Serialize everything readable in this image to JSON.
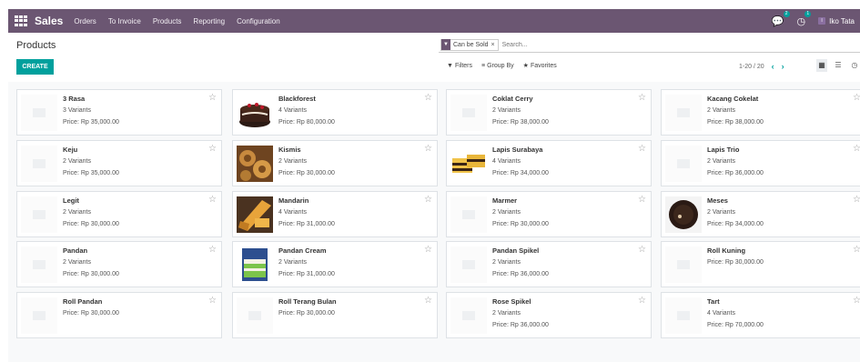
{
  "navbar": {
    "app_name": "Sales",
    "menu": [
      "Orders",
      "To Invoice",
      "Products",
      "Reporting",
      "Configuration"
    ],
    "messages_count": "2",
    "activities_count": "1",
    "user_name": "Iko Tata"
  },
  "control": {
    "title": "Products",
    "create_label": "CREATE",
    "facet_label": "Can be Sold",
    "search_placeholder": "Search...",
    "filters_label": "Filters",
    "groupby_label": "Group By",
    "favorites_label": "Favorites",
    "pager": "1-20 / 20"
  },
  "products": [
    {
      "name": "3 Rasa",
      "variants": "3 Variants",
      "price": "Price: Rp 35,000.00",
      "image": "placeholder"
    },
    {
      "name": "Blackforest",
      "variants": "4 Variants",
      "price": "Price: Rp 80,000.00",
      "image": "cake-photo"
    },
    {
      "name": "Coklat Cerry",
      "variants": "2 Variants",
      "price": "Price: Rp 38,000.00",
      "image": "placeholder"
    },
    {
      "name": "Kacang Cokelat",
      "variants": "2 Variants",
      "price": "Price: Rp 38,000.00",
      "image": "placeholder"
    },
    {
      "name": "Keju",
      "variants": "2 Variants",
      "price": "Price: Rp 35,000.00",
      "image": "placeholder"
    },
    {
      "name": "Kismis",
      "variants": "2 Variants",
      "price": "Price: Rp 30,000.00",
      "image": "roll-photo"
    },
    {
      "name": "Lapis Surabaya",
      "variants": "4 Variants",
      "price": "Price: Rp 34,000.00",
      "image": "layer-photo"
    },
    {
      "name": "Lapis Trio",
      "variants": "2 Variants",
      "price": "Price: Rp 36,000.00",
      "image": "placeholder"
    },
    {
      "name": "Legit",
      "variants": "2 Variants",
      "price": "Price: Rp 30,000.00",
      "image": "placeholder"
    },
    {
      "name": "Mandarin",
      "variants": "4 Variants",
      "price": "Price: Rp 31,000.00",
      "image": "orange-cake-photo"
    },
    {
      "name": "Marmer",
      "variants": "2 Variants",
      "price": "Price: Rp 30,000.00",
      "image": "placeholder"
    },
    {
      "name": "Meses",
      "variants": "2 Variants",
      "price": "Price: Rp 34,000.00",
      "image": "dark-roll-photo"
    },
    {
      "name": "Pandan",
      "variants": "2 Variants",
      "price": "Price: Rp 30,000.00",
      "image": "placeholder"
    },
    {
      "name": "Pandan Cream",
      "variants": "2 Variants",
      "price": "Price: Rp 31,000.00",
      "image": "green-cake-photo"
    },
    {
      "name": "Pandan Spikel",
      "variants": "2 Variants",
      "price": "Price: Rp 36,000.00",
      "image": "placeholder"
    },
    {
      "name": "Roll Kuning",
      "variants": "",
      "price": "Price: Rp 30,000.00",
      "image": "placeholder"
    },
    {
      "name": "Roll Pandan",
      "variants": "",
      "price": "Price: Rp 30,000.00",
      "image": "placeholder"
    },
    {
      "name": "Roll Terang Bulan",
      "variants": "",
      "price": "Price: Rp 30,000.00",
      "image": "placeholder"
    },
    {
      "name": "Rose Spikel",
      "variants": "2 Variants",
      "price": "Price: Rp 36,000.00",
      "image": "placeholder"
    },
    {
      "name": "Tart",
      "variants": "4 Variants",
      "price": "Price: Rp 70,000.00",
      "image": "placeholder"
    }
  ]
}
